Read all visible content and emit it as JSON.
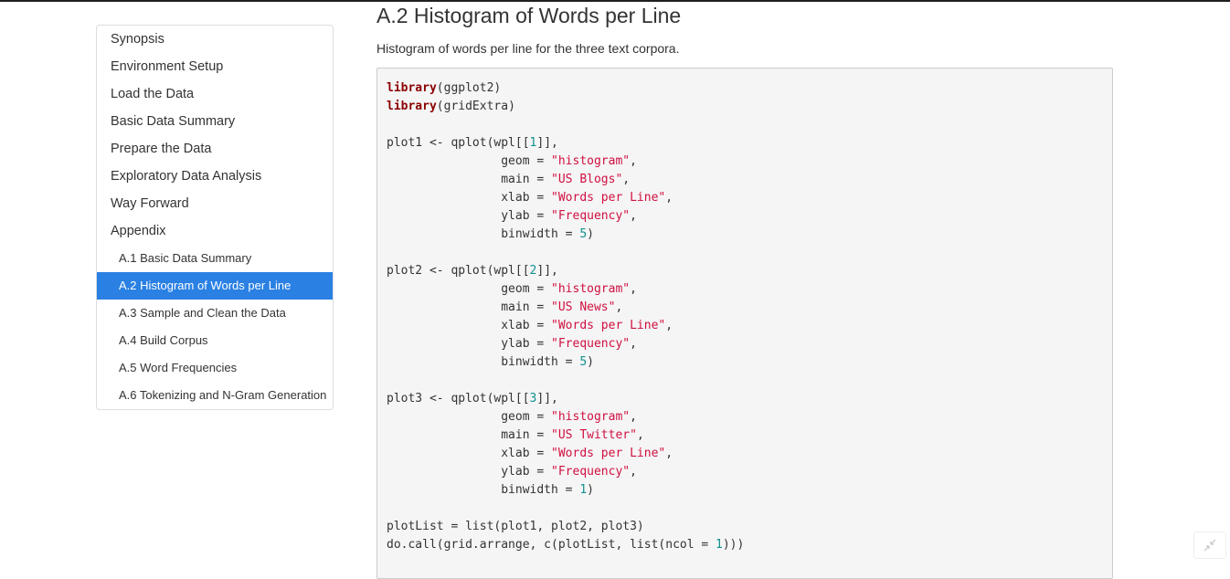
{
  "toc": {
    "items": [
      {
        "label": "Synopsis",
        "level": 1,
        "active": false
      },
      {
        "label": "Environment Setup",
        "level": 1,
        "active": false
      },
      {
        "label": "Load the Data",
        "level": 1,
        "active": false
      },
      {
        "label": "Basic Data Summary",
        "level": 1,
        "active": false
      },
      {
        "label": "Prepare the Data",
        "level": 1,
        "active": false
      },
      {
        "label": "Exploratory Data Analysis",
        "level": 1,
        "active": false
      },
      {
        "label": "Way Forward",
        "level": 1,
        "active": false
      },
      {
        "label": "Appendix",
        "level": 1,
        "active": false
      },
      {
        "label": "A.1 Basic Data Summary",
        "level": 2,
        "active": false
      },
      {
        "label": "A.2 Histogram of Words per Line",
        "level": 2,
        "active": true
      },
      {
        "label": "A.3 Sample and Clean the Data",
        "level": 2,
        "active": false
      },
      {
        "label": "A.4 Build Corpus",
        "level": 2,
        "active": false
      },
      {
        "label": "A.5 Word Frequencies",
        "level": 2,
        "active": false
      },
      {
        "label": "A.6 Tokenizing and N-Gram Generation",
        "level": 2,
        "active": false
      }
    ]
  },
  "main": {
    "title": "A.2 Histogram of Words per Line",
    "description": "Histogram of words per line for the three text corpora.",
    "code": [
      [
        [
          "kw",
          "library"
        ],
        [
          "p",
          "(ggplot2)"
        ]
      ],
      [
        [
          "kw",
          "library"
        ],
        [
          "p",
          "(gridExtra)"
        ]
      ],
      [],
      [
        [
          "p",
          "plot1 <- qplot(wpl[["
        ],
        [
          "num",
          "1"
        ],
        [
          "p",
          "]],"
        ]
      ],
      [
        [
          "p",
          "                geom = "
        ],
        [
          "str",
          "\"histogram\""
        ],
        [
          "p",
          ","
        ]
      ],
      [
        [
          "p",
          "                main = "
        ],
        [
          "str",
          "\"US Blogs\""
        ],
        [
          "p",
          ","
        ]
      ],
      [
        [
          "p",
          "                xlab = "
        ],
        [
          "str",
          "\"Words per Line\""
        ],
        [
          "p",
          ","
        ]
      ],
      [
        [
          "p",
          "                ylab = "
        ],
        [
          "str",
          "\"Frequency\""
        ],
        [
          "p",
          ","
        ]
      ],
      [
        [
          "p",
          "                binwidth = "
        ],
        [
          "num",
          "5"
        ],
        [
          "p",
          ")"
        ]
      ],
      [],
      [
        [
          "p",
          "plot2 <- qplot(wpl[["
        ],
        [
          "num",
          "2"
        ],
        [
          "p",
          "]],"
        ]
      ],
      [
        [
          "p",
          "                geom = "
        ],
        [
          "str",
          "\"histogram\""
        ],
        [
          "p",
          ","
        ]
      ],
      [
        [
          "p",
          "                main = "
        ],
        [
          "str",
          "\"US News\""
        ],
        [
          "p",
          ","
        ]
      ],
      [
        [
          "p",
          "                xlab = "
        ],
        [
          "str",
          "\"Words per Line\""
        ],
        [
          "p",
          ","
        ]
      ],
      [
        [
          "p",
          "                ylab = "
        ],
        [
          "str",
          "\"Frequency\""
        ],
        [
          "p",
          ","
        ]
      ],
      [
        [
          "p",
          "                binwidth = "
        ],
        [
          "num",
          "5"
        ],
        [
          "p",
          ")"
        ]
      ],
      [],
      [
        [
          "p",
          "plot3 <- qplot(wpl[["
        ],
        [
          "num",
          "3"
        ],
        [
          "p",
          "]],"
        ]
      ],
      [
        [
          "p",
          "                geom = "
        ],
        [
          "str",
          "\"histogram\""
        ],
        [
          "p",
          ","
        ]
      ],
      [
        [
          "p",
          "                main = "
        ],
        [
          "str",
          "\"US Twitter\""
        ],
        [
          "p",
          ","
        ]
      ],
      [
        [
          "p",
          "                xlab = "
        ],
        [
          "str",
          "\"Words per Line\""
        ],
        [
          "p",
          ","
        ]
      ],
      [
        [
          "p",
          "                ylab = "
        ],
        [
          "str",
          "\"Frequency\""
        ],
        [
          "p",
          ","
        ]
      ],
      [
        [
          "p",
          "                binwidth = "
        ],
        [
          "num",
          "1"
        ],
        [
          "p",
          ")"
        ]
      ],
      [],
      [
        [
          "p",
          "plotList = list(plot1, plot2, plot3)"
        ]
      ],
      [
        [
          "p",
          "do.call(grid.arrange, c(plotList, list(ncol = "
        ],
        [
          "num",
          "1"
        ],
        [
          "p",
          ")))"
        ]
      ]
    ]
  },
  "colors": {
    "accent": "#2a80e3",
    "keyword": "#8b0000",
    "string": "#d01040",
    "number": "#109090",
    "code_bg": "#f5f5f5"
  },
  "icons": {
    "corner_button": "collapse-arrows-icon"
  }
}
